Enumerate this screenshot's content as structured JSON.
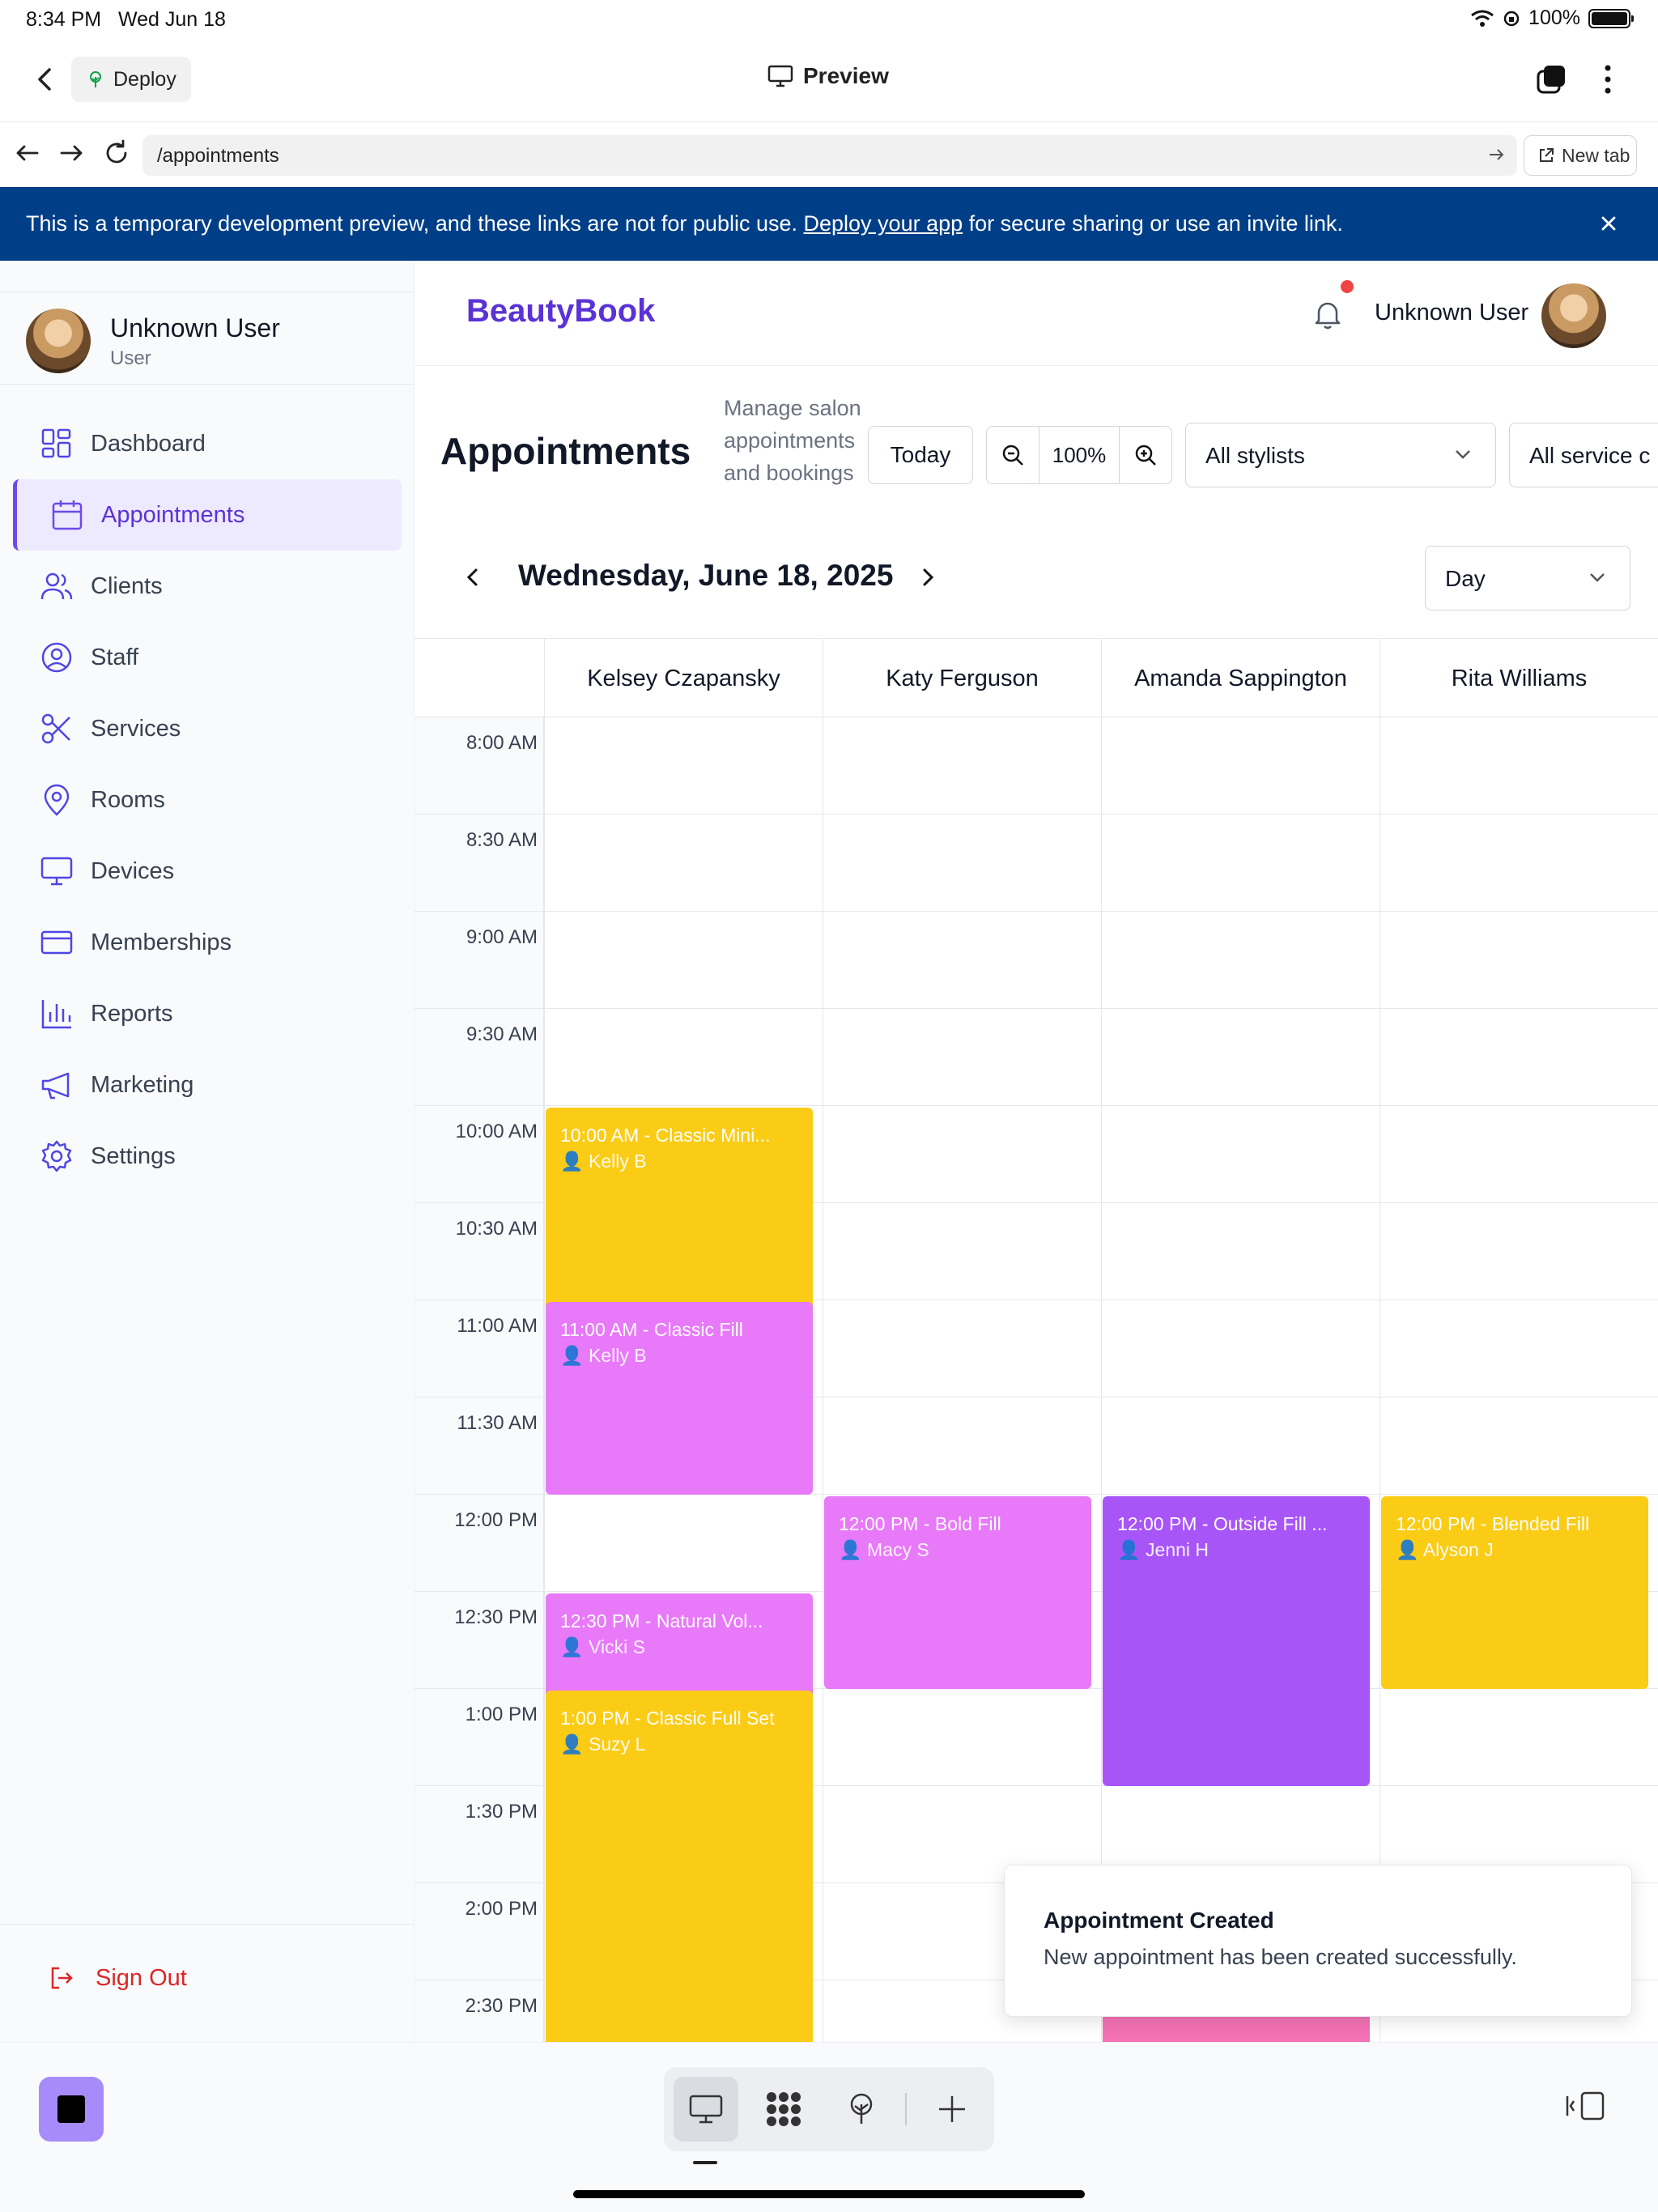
{
  "status_bar": {
    "time": "8:34 PM",
    "date": "Wed Jun 18",
    "battery": "100%"
  },
  "toolbar": {
    "deploy_label": "Deploy",
    "preview_label": "Preview"
  },
  "url_bar": {
    "url": "/appointments",
    "new_tab_label": "New tab"
  },
  "banner": {
    "text_before": "This is a temporary development preview, and these links are not for public use. ",
    "link_text": "Deploy your app",
    "text_after": " for secure sharing or use an invite link."
  },
  "sidebar": {
    "user_name": "Unknown User",
    "user_role": "User",
    "items": [
      {
        "label": "Dashboard",
        "icon": "dashboard-icon"
      },
      {
        "label": "Appointments",
        "icon": "calendar-icon",
        "active": true
      },
      {
        "label": "Clients",
        "icon": "users-icon"
      },
      {
        "label": "Staff",
        "icon": "user-circle-icon"
      },
      {
        "label": "Services",
        "icon": "scissors-icon"
      },
      {
        "label": "Rooms",
        "icon": "map-pin-icon"
      },
      {
        "label": "Devices",
        "icon": "monitor-icon"
      },
      {
        "label": "Memberships",
        "icon": "credit-card-icon"
      },
      {
        "label": "Reports",
        "icon": "bar-chart-icon"
      },
      {
        "label": "Marketing",
        "icon": "megaphone-icon"
      },
      {
        "label": "Settings",
        "icon": "gear-icon"
      }
    ],
    "sign_out_label": "Sign Out"
  },
  "header": {
    "brand": "BeautyBook",
    "user_name": "Unknown User"
  },
  "page": {
    "title": "Appointments",
    "description": "Manage salon appointments and bookings",
    "today_label": "Today",
    "zoom_level": "100%",
    "stylist_filter": "All stylists",
    "service_filter": "All service c",
    "date_label": "Wednesday, June 18, 2025",
    "view_mode": "Day"
  },
  "calendar": {
    "stylists": [
      "Kelsey Czapansky",
      "Katy Ferguson",
      "Amanda Sappington",
      "Rita Williams"
    ],
    "time_slots": [
      "8:00 AM",
      "8:30 AM",
      "9:00 AM",
      "9:30 AM",
      "10:00 AM",
      "10:30 AM",
      "11:00 AM",
      "11:30 AM",
      "12:00 PM",
      "12:30 PM",
      "1:00 PM",
      "1:30 PM",
      "2:00 PM",
      "2:30 PM"
    ],
    "appointments": [
      {
        "col": 0,
        "title": "10:00 AM - Classic Mini...",
        "client": "Kelly B",
        "color": "#facc15"
      },
      {
        "col": 0,
        "title": "11:00 AM - Classic Fill",
        "client": "Kelly B",
        "color": "#e879f9"
      },
      {
        "col": 0,
        "title": "12:30 PM - Natural Vol...",
        "client": "Vicki S",
        "color": "#e879f9"
      },
      {
        "col": 0,
        "title": "1:00 PM - Classic Full Set",
        "client": "Suzy L",
        "color": "#facc15"
      },
      {
        "col": 1,
        "title": "12:00 PM - Bold Fill",
        "client": "Macy S",
        "color": "#e879f9"
      },
      {
        "col": 2,
        "title": "12:00 PM - Outside Fill ...",
        "client": "Jenni H",
        "color": "#a855f7"
      },
      {
        "col": 3,
        "title": "12:00 PM - Blended Fill",
        "client": "Alyson J",
        "color": "#facc15"
      }
    ]
  },
  "toast": {
    "title": "Appointment Created",
    "message": "New appointment has been created successfully."
  },
  "colors": {
    "brand": "#5b32d6",
    "banner": "#003f87",
    "danger": "#dc2626"
  }
}
